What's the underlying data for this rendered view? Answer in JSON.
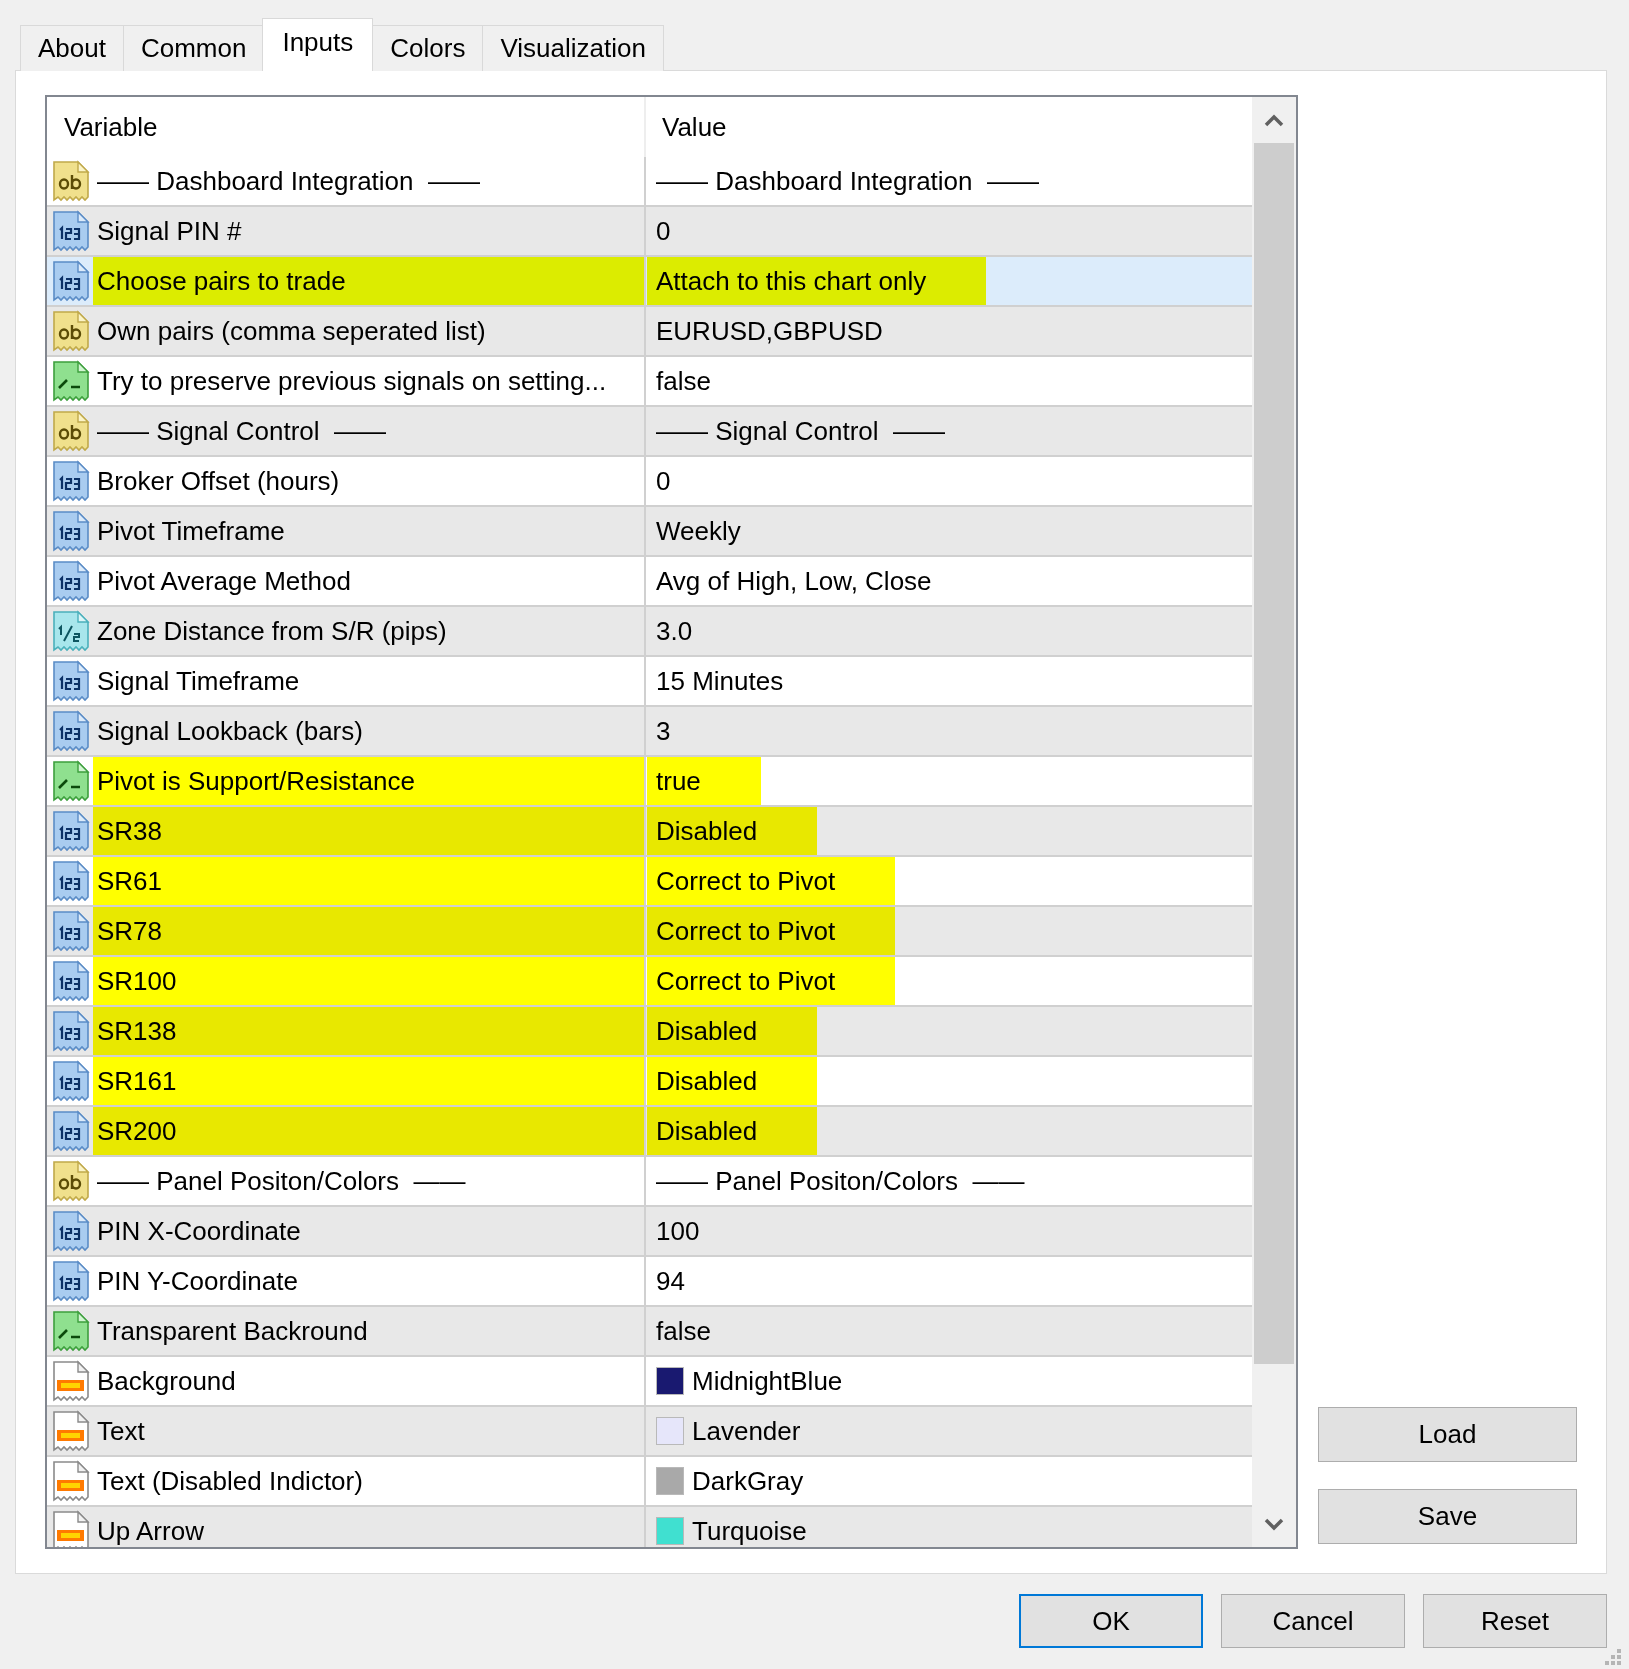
{
  "tabs": [
    {
      "label": "About",
      "selected": false
    },
    {
      "label": "Common",
      "selected": false
    },
    {
      "label": "Inputs",
      "selected": true
    },
    {
      "label": "Colors",
      "selected": false
    },
    {
      "label": "Visualization",
      "selected": false
    }
  ],
  "table": {
    "columns": [
      "Variable",
      "Value"
    ],
    "rows": [
      {
        "kind": "string",
        "variable": "—— Dashboard Integration  ——",
        "value": "—— Dashboard Integration  ——",
        "selected": false,
        "highlighted": false
      },
      {
        "kind": "integer",
        "variable": "Signal PIN #",
        "value": "0",
        "selected": false,
        "highlighted": false
      },
      {
        "kind": "integer",
        "variable": "Choose pairs to trade",
        "value": "Attach to this chart only",
        "selected": true,
        "highlighted": true
      },
      {
        "kind": "string",
        "variable": "Own pairs (comma seperated list)",
        "value": "EURUSD,GBPUSD",
        "selected": false,
        "highlighted": false
      },
      {
        "kind": "boolean",
        "variable": "Try to preserve previous signals on setting...",
        "value": "false",
        "selected": false,
        "highlighted": false
      },
      {
        "kind": "string",
        "variable": "—— Signal Control  ——",
        "value": "—— Signal Control  ——",
        "selected": false,
        "highlighted": false
      },
      {
        "kind": "integer",
        "variable": "Broker Offset (hours)",
        "value": "0",
        "selected": false,
        "highlighted": false
      },
      {
        "kind": "integer",
        "variable": "Pivot Timeframe",
        "value": "Weekly",
        "selected": false,
        "highlighted": false
      },
      {
        "kind": "integer",
        "variable": "Pivot Average Method",
        "value": "Avg of High, Low, Close",
        "selected": false,
        "highlighted": false
      },
      {
        "kind": "double",
        "variable": "Zone Distance from S/R (pips)",
        "value": "3.0",
        "selected": false,
        "highlighted": false
      },
      {
        "kind": "integer",
        "variable": "Signal Timeframe",
        "value": "15 Minutes",
        "selected": false,
        "highlighted": false
      },
      {
        "kind": "integer",
        "variable": "Signal Lookback (bars)",
        "value": "3",
        "selected": false,
        "highlighted": false
      },
      {
        "kind": "boolean",
        "variable": "Pivot is Support/Resistance",
        "value": "true",
        "selected": false,
        "highlighted": true
      },
      {
        "kind": "integer",
        "variable": "SR38",
        "value": "Disabled",
        "selected": false,
        "highlighted": true
      },
      {
        "kind": "integer",
        "variable": "SR61",
        "value": "Correct to Pivot",
        "selected": false,
        "highlighted": true
      },
      {
        "kind": "integer",
        "variable": "SR78",
        "value": "Correct to Pivot",
        "selected": false,
        "highlighted": true
      },
      {
        "kind": "integer",
        "variable": "SR100",
        "value": "Correct to Pivot",
        "selected": false,
        "highlighted": true
      },
      {
        "kind": "integer",
        "variable": "SR138",
        "value": "Disabled",
        "selected": false,
        "highlighted": true
      },
      {
        "kind": "integer",
        "variable": "SR161",
        "value": "Disabled",
        "selected": false,
        "highlighted": true
      },
      {
        "kind": "integer",
        "variable": "SR200",
        "value": "Disabled",
        "selected": false,
        "highlighted": true
      },
      {
        "kind": "string",
        "variable": "—— Panel Positon/Colors  ——",
        "value": "—— Panel Positon/Colors  ——",
        "selected": false,
        "highlighted": false
      },
      {
        "kind": "integer",
        "variable": "PIN X-Coordinate",
        "value": "100",
        "selected": false,
        "highlighted": false
      },
      {
        "kind": "integer",
        "variable": "PIN Y-Coordinate",
        "value": "94",
        "selected": false,
        "highlighted": false
      },
      {
        "kind": "boolean",
        "variable": "Transparent Backround",
        "value": "false",
        "selected": false,
        "highlighted": false
      },
      {
        "kind": "color",
        "variable": "Background",
        "value": "MidnightBlue",
        "color": "#191970",
        "selected": false,
        "highlighted": false
      },
      {
        "kind": "color",
        "variable": "Text",
        "value": "Lavender",
        "color": "#e6e6fa",
        "selected": false,
        "highlighted": false
      },
      {
        "kind": "color",
        "variable": "Text (Disabled Indictor)",
        "value": "DarkGray",
        "color": "#a9a9a9",
        "selected": false,
        "highlighted": false
      },
      {
        "kind": "color",
        "variable": "Up Arrow",
        "value": "Turquoise",
        "color": "#40e0d0",
        "selected": false,
        "highlighted": false
      }
    ]
  },
  "side_buttons": [
    {
      "label": "Load"
    },
    {
      "label": "Save"
    }
  ],
  "dialog_buttons": [
    {
      "label": "OK",
      "default": true
    },
    {
      "label": "Cancel",
      "default": false
    },
    {
      "label": "Reset",
      "default": false
    }
  ]
}
